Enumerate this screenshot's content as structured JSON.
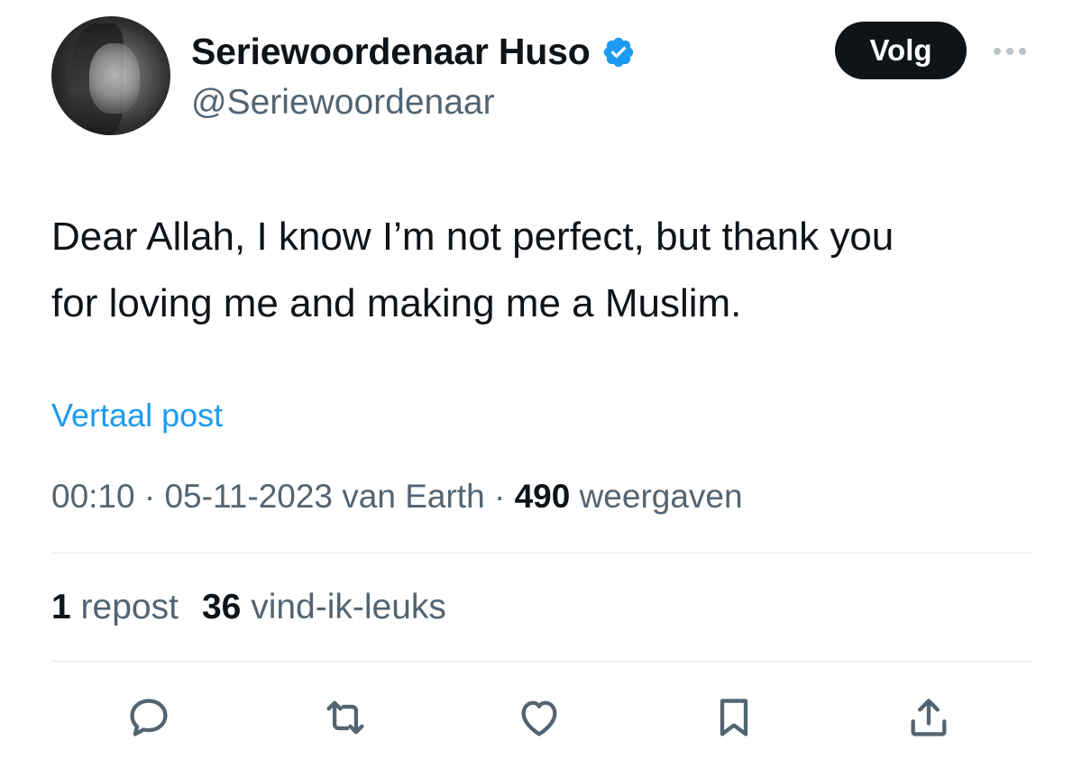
{
  "author": {
    "display_name": "Seriewoordenaar Huso",
    "handle": "@Seriewoordenaar",
    "verified": true
  },
  "follow_label": "Volg",
  "tweet": {
    "lines": [
      "Dear Allah, I know I’m not perfect, but thank you",
      "for loving me and making me a Muslim."
    ]
  },
  "translate_label": "Vertaal post",
  "meta": {
    "time": "00:10",
    "separator": "·",
    "date": "05-11-2023",
    "source": "van Earth",
    "views": "490",
    "views_label": "weergaven"
  },
  "stats": {
    "reposts": "1",
    "reposts_label": "repost",
    "likes": "36",
    "likes_label": "vind-ik-leuks"
  },
  "colors": {
    "text": "#0f1419",
    "secondary": "#536471",
    "accent": "#1d9bf0",
    "divider": "#e1e6ea"
  },
  "actions": [
    "reply-icon",
    "repost-icon",
    "like-icon",
    "bookmark-icon",
    "share-icon"
  ]
}
